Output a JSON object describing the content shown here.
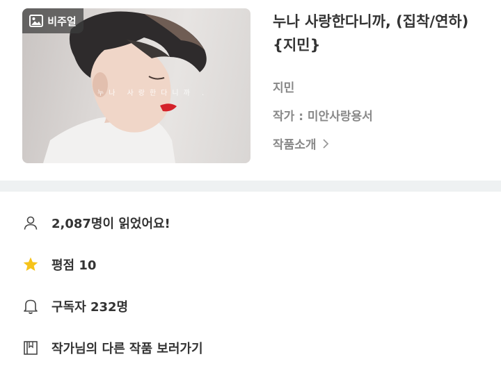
{
  "work": {
    "title": "누나 사랑한다니까, (집착/연하) {지민}",
    "genre": "지민",
    "author_label": "작가 : 미안사랑용서",
    "intro_label": "작품소개"
  },
  "cover": {
    "badge_label": "비주얼",
    "overlay_text": "누나 사랑한다니까 ."
  },
  "stats": {
    "readers": "2,087명이 읽었어요!",
    "rating": "평점 10",
    "subscribers": "구독자 232명",
    "other_works": "작가님의 다른 작품 보러가기"
  },
  "colors": {
    "divider": "#eef1f2",
    "star": "#f6c31a",
    "muted_text": "#888888"
  }
}
